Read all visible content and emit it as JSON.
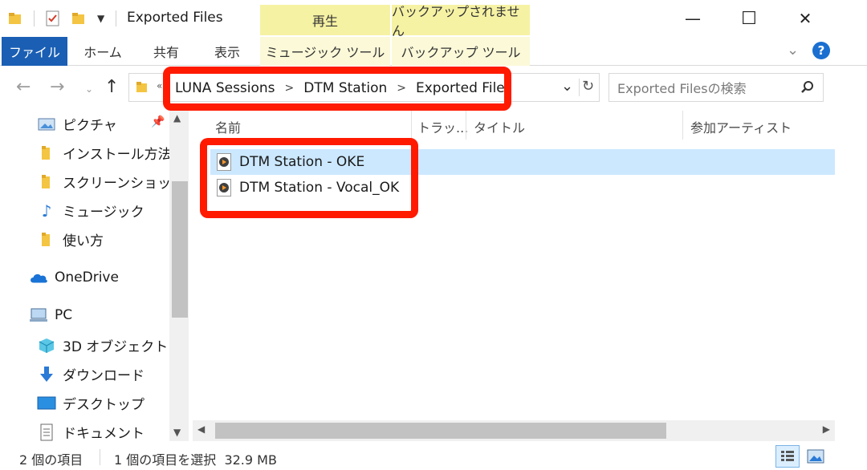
{
  "window": {
    "title": "Exported Files",
    "minimize_glyph": "—",
    "maximize_glyph": "☐",
    "close_glyph": "✕"
  },
  "contextual_tabs": {
    "play": "再生",
    "not_backed_up": "バックアップされません"
  },
  "ribbon": {
    "file": "ファイル",
    "home": "ホーム",
    "share": "共有",
    "view": "表示",
    "music_tools": "ミュージック ツール",
    "backup_tools": "バックアップ ツール"
  },
  "address": {
    "breadcrumbs": [
      "LUNA Sessions",
      "DTM Station",
      "Exported Files"
    ],
    "search_placeholder": "Exported Filesの検索"
  },
  "nav_pane": {
    "items": [
      {
        "label": "ピクチャ",
        "icon": "pictures-icon"
      },
      {
        "label": "インストール方法",
        "icon": "folder-icon"
      },
      {
        "label": "スクリーンショット",
        "icon": "folder-icon"
      },
      {
        "label": "ミュージック",
        "icon": "music-icon"
      },
      {
        "label": "使い方",
        "icon": "folder-icon"
      },
      {
        "label": "OneDrive",
        "icon": "onedrive-icon"
      },
      {
        "label": "PC",
        "icon": "pc-icon"
      },
      {
        "label": "3D オブジェクト",
        "icon": "3d-objects-icon"
      },
      {
        "label": "ダウンロード",
        "icon": "download-icon"
      },
      {
        "label": "デスクトップ",
        "icon": "desktop-icon"
      },
      {
        "label": "ドキュメント",
        "icon": "documents-icon"
      }
    ]
  },
  "columns": {
    "name": "名前",
    "track": "トラッ...",
    "title": "タイトル",
    "artist": "参加アーティスト"
  },
  "files": [
    {
      "name": "DTM Station - OKE",
      "selected": true
    },
    {
      "name": "DTM Station - Vocal_OK",
      "selected": false
    }
  ],
  "status": {
    "item_count": "2 個の項目",
    "selection": "1 個の項目を選択  32.9 MB"
  },
  "colors": {
    "accent": "#1a5fb4",
    "highlight": "#ff1a00",
    "selected_row": "#cce8ff",
    "context_tab": "#f6f2a4"
  }
}
